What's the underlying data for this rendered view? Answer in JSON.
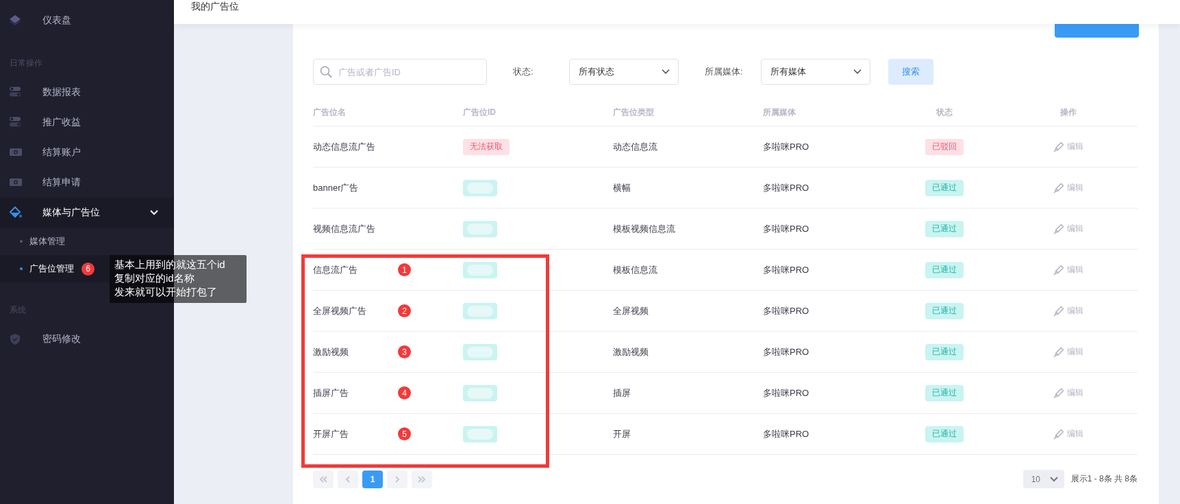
{
  "sidebar": {
    "items": [
      {
        "kind": "item",
        "label": "仪表盘",
        "selected": false
      },
      {
        "kind": "section",
        "label": "日常操作"
      },
      {
        "kind": "item",
        "label": "数据报表",
        "selected": false
      },
      {
        "kind": "item",
        "label": "推广收益",
        "selected": false
      },
      {
        "kind": "item",
        "label": "结算账户",
        "selected": false
      },
      {
        "kind": "item",
        "label": "结算申请",
        "selected": false
      },
      {
        "kind": "group",
        "label": "媒体与广告位",
        "selected": true,
        "expanded": true,
        "children": [
          {
            "label": "媒体管理",
            "selected": false
          },
          {
            "label": "广告位管理",
            "selected": true,
            "marker": "6",
            "note": [
              "基本上用到的就这五个id",
              "复制对应的id名称",
              "发来就可以开始打包了"
            ]
          }
        ]
      },
      {
        "kind": "section",
        "label": "系统"
      },
      {
        "kind": "item",
        "label": "密码修改",
        "selected": false
      }
    ]
  },
  "header": {
    "title": "我的广告位"
  },
  "card": {
    "new_button": {
      "kind": "stub"
    }
  },
  "filters": {
    "search": {
      "placeholder": "广告或者广告ID"
    },
    "status_label": "状态:",
    "status_value": "所有状态",
    "media_label": "所属媒体:",
    "media_value": "所有媒体",
    "search_button": "搜索"
  },
  "table": {
    "columns": [
      "广告位名",
      "广告位ID",
      "广告位类型",
      "所属媒体",
      "状态",
      "操作"
    ],
    "rows": [
      {
        "name": "动态信息流广告",
        "id": {
          "kind": "error",
          "text": "无法获取"
        },
        "type": "动态信息流",
        "media": "多啦咪PRO",
        "status": {
          "kind": "rejected",
          "text": "已驳回"
        },
        "action": "编辑",
        "framed": false
      },
      {
        "name": "banner广告",
        "id": {
          "kind": "redacted"
        },
        "type": "横幅",
        "media": "多啦咪PRO",
        "status": {
          "kind": "approved",
          "text": "已通过"
        },
        "action": "编辑",
        "framed": false
      },
      {
        "name": "视频信息流广告",
        "id": {
          "kind": "redacted"
        },
        "type": "模板视频信息流",
        "media": "多啦咪PRO",
        "status": {
          "kind": "approved",
          "text": "已通过"
        },
        "action": "编辑",
        "framed": false
      },
      {
        "name": "信息流广告",
        "id": {
          "kind": "redacted"
        },
        "type": "模板信息流",
        "media": "多啦咪PRO",
        "status": {
          "kind": "approved",
          "text": "已通过"
        },
        "action": "编辑",
        "framed": true,
        "marker": "1"
      },
      {
        "name": "全屏视频广告",
        "id": {
          "kind": "redacted"
        },
        "type": "全屏视频",
        "media": "多啦咪PRO",
        "status": {
          "kind": "approved",
          "text": "已通过"
        },
        "action": "编辑",
        "framed": true,
        "marker": "2"
      },
      {
        "name": "激励视频",
        "id": {
          "kind": "redacted"
        },
        "type": "激励视频",
        "media": "多啦咪PRO",
        "status": {
          "kind": "approved",
          "text": "已通过"
        },
        "action": "编辑",
        "framed": true,
        "marker": "3"
      },
      {
        "name": "插屏广告",
        "id": {
          "kind": "redacted"
        },
        "type": "插屏",
        "media": "多啦咪PRO",
        "status": {
          "kind": "approved",
          "text": "已通过"
        },
        "action": "编辑",
        "framed": true,
        "marker": "4"
      },
      {
        "name": "开屏广告",
        "id": {
          "kind": "redacted"
        },
        "type": "开屏",
        "media": "多啦咪PRO",
        "status": {
          "kind": "approved",
          "text": "已通过"
        },
        "action": "编辑",
        "framed": true,
        "marker": "5"
      }
    ]
  },
  "pagination": {
    "pages": [
      {
        "label": "1",
        "selected": true
      }
    ],
    "page_size": "10",
    "summary": "展示1 - 8条 共 8条"
  }
}
